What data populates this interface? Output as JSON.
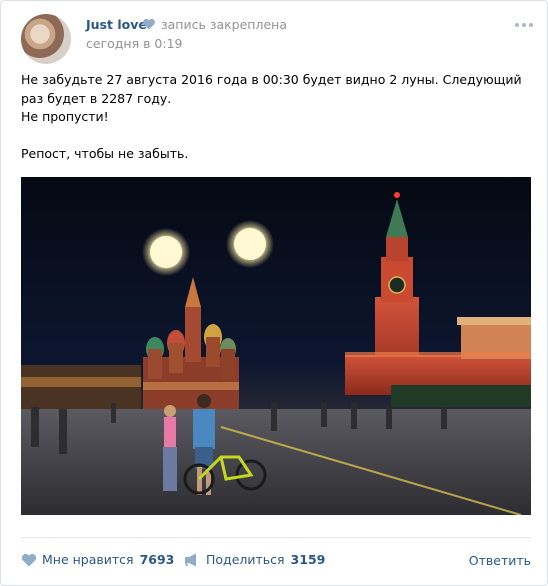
{
  "post": {
    "author": "Just love",
    "pinned_label": "запись закреплена",
    "time": "сегодня в 0:19",
    "text_lines": [
      "Не забудьте 27 августа 2016 года в 00:30 будет видно 2 луны. Следующий раз будет в 2287 году.",
      "Не пропусти!",
      "",
      "Репост, чтобы не забыть."
    ],
    "photo_icon": "red-square-two-moons-photo"
  },
  "footer": {
    "like_label": "Мне нравится",
    "like_count": "7693",
    "share_label": "Поделиться",
    "share_count": "3159",
    "reply_label": "Ответить"
  },
  "colors": {
    "link": "#2a5885",
    "meta": "#939393",
    "icon": "#8fadc8",
    "border": "#dce1e6"
  }
}
